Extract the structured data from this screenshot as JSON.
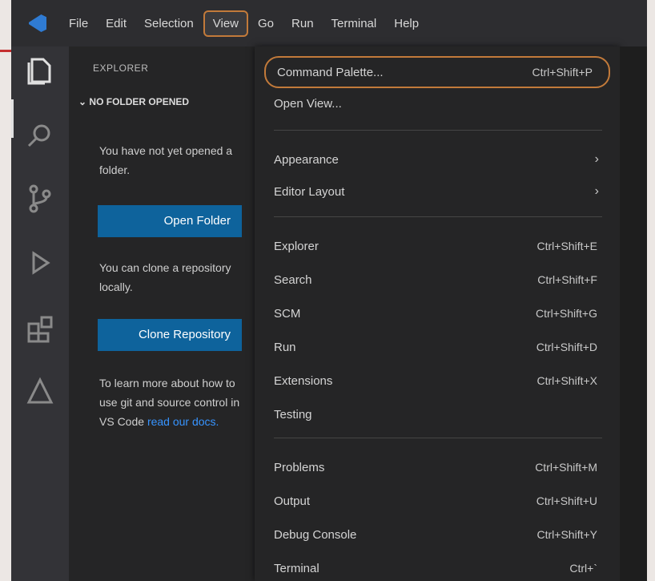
{
  "menubar": {
    "items": [
      "File",
      "Edit",
      "Selection",
      "View",
      "Go",
      "Run",
      "Terminal",
      "Help"
    ],
    "active_index": 3
  },
  "sidebar": {
    "title": "EXPLORER",
    "section": "NO FOLDER OPENED",
    "text1": "You have not yet opened a folder.",
    "open_folder_button": "Open Folder",
    "text2": "You can clone a repository locally.",
    "clone_button": "Clone Repository",
    "text3_prefix": "To learn more about how to use git and source control in VS Code ",
    "text3_link": "read our docs."
  },
  "view_menu": {
    "groups": [
      [
        {
          "label": "Command Palette...",
          "shortcut": "Ctrl+Shift+P",
          "highlighted": true
        },
        {
          "label": "Open View...",
          "shortcut": ""
        }
      ],
      [
        {
          "label": "Appearance",
          "submenu": true
        },
        {
          "label": "Editor Layout",
          "submenu": true
        }
      ],
      [
        {
          "label": "Explorer",
          "shortcut": "Ctrl+Shift+E"
        },
        {
          "label": "Search",
          "shortcut": "Ctrl+Shift+F"
        },
        {
          "label": "SCM",
          "shortcut": "Ctrl+Shift+G"
        },
        {
          "label": "Run",
          "shortcut": "Ctrl+Shift+D"
        },
        {
          "label": "Extensions",
          "shortcut": "Ctrl+Shift+X"
        },
        {
          "label": "Testing",
          "shortcut": ""
        }
      ],
      [
        {
          "label": "Problems",
          "shortcut": "Ctrl+Shift+M"
        },
        {
          "label": "Output",
          "shortcut": "Ctrl+Shift+U"
        },
        {
          "label": "Debug Console",
          "shortcut": "Ctrl+Shift+Y"
        },
        {
          "label": "Terminal",
          "shortcut": "Ctrl+`"
        }
      ]
    ],
    "submenu_glyph": "›"
  },
  "activity_icons": [
    "explorer-icon",
    "search-icon",
    "source-control-icon",
    "run-debug-icon",
    "extensions-icon",
    "testing-icon"
  ],
  "colors": {
    "highlight_outline": "#c27a3a",
    "button_blue": "#0e639c",
    "link": "#3794ff"
  }
}
